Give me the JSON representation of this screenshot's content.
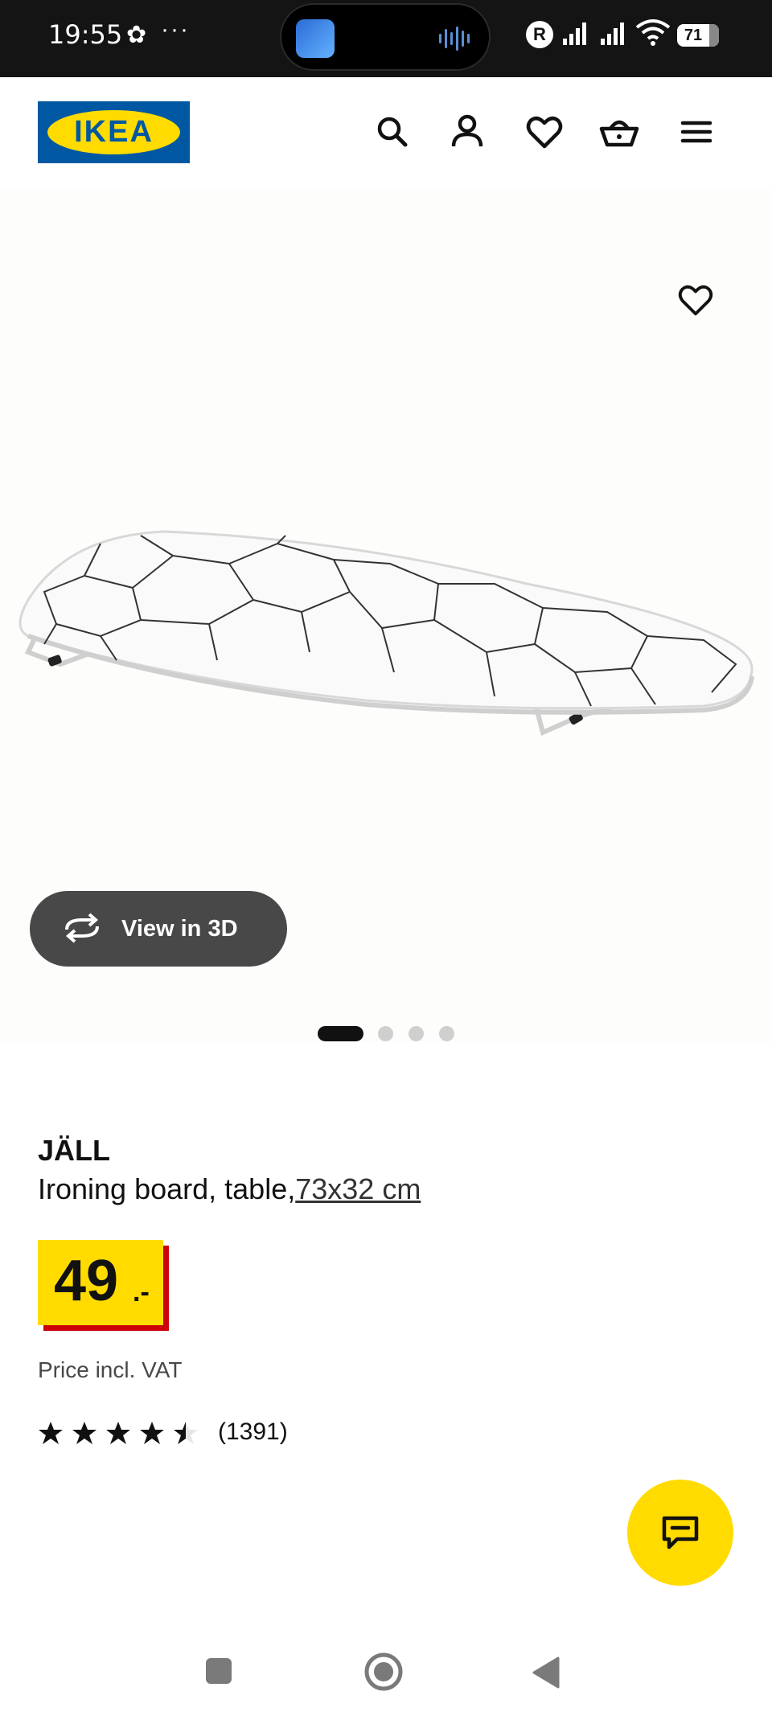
{
  "status_bar": {
    "time": "19:55",
    "overflow": "···",
    "network_badge": "R",
    "battery": "71",
    "wifi_sub": "6"
  },
  "header": {
    "logo_text": "IKEA",
    "icons": [
      "search-icon",
      "account-icon",
      "favourites-icon",
      "basket-icon",
      "menu-icon"
    ]
  },
  "gallery": {
    "view_3d_label": "View in 3D",
    "slide_count": 4,
    "active_slide": 1
  },
  "product": {
    "name": "JÄLL",
    "description": "Ironing board, table,",
    "size": "73x32 cm",
    "price_integer": "49",
    "price_decimal": ".-",
    "vat_note": "Price incl. VAT",
    "rating_value": 4.5,
    "rating_count": "(1391)"
  },
  "colors": {
    "brand_blue": "#0058a3",
    "brand_yellow": "#ffdb00",
    "price_red": "#cc0008"
  }
}
